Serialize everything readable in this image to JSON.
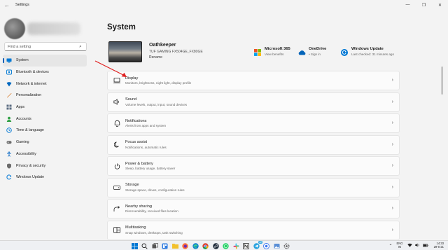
{
  "window": {
    "title": "Settings",
    "back_icon": "back-arrow-icon"
  },
  "sidebar": {
    "search_placeholder": "Find a setting",
    "items": [
      {
        "label": "System",
        "icon": "monitor-icon",
        "color": "#0078d4",
        "selected": true
      },
      {
        "label": "Bluetooth & devices",
        "icon": "bluetooth-icon",
        "color": "#0078d4"
      },
      {
        "label": "Network & internet",
        "icon": "wifi-icon",
        "color": "#0067c0"
      },
      {
        "label": "Personalization",
        "icon": "brush-icon",
        "color": "#d87a25"
      },
      {
        "label": "Apps",
        "icon": "apps-icon",
        "color": "#5a6b80"
      },
      {
        "label": "Accounts",
        "icon": "person-icon",
        "color": "#2ea043"
      },
      {
        "label": "Time & language",
        "icon": "globe-clock-icon",
        "color": "#0078d4"
      },
      {
        "label": "Gaming",
        "icon": "gamepad-icon",
        "color": "#6b6b6b"
      },
      {
        "label": "Accessibility",
        "icon": "accessibility-icon",
        "color": "#1a73c8"
      },
      {
        "label": "Privacy & security",
        "icon": "shield-icon",
        "color": "#6b6b6b"
      },
      {
        "label": "Windows Update",
        "icon": "sync-icon",
        "color": "#0078d4"
      }
    ]
  },
  "main": {
    "title": "System",
    "device": {
      "name": "Oathkeeper",
      "model": "TUF GAMING FX504GE_FX80GE",
      "rename": "Rename"
    },
    "quick": [
      {
        "title": "Microsoft 365",
        "sub": "View benefits",
        "icon": "microsoft-logo-icon"
      },
      {
        "title": "OneDrive",
        "sub": "• Sign in",
        "icon": "cloud-icon"
      },
      {
        "title": "Windows Update",
        "sub": "Last checked: 31 minutes ago",
        "icon": "update-icon"
      }
    ],
    "cards": [
      {
        "title": "Display",
        "sub": "Monitors, brightness, night light, display profile",
        "icon": "display-icon"
      },
      {
        "title": "Sound",
        "sub": "Volume levels, output, input, sound devices",
        "icon": "speaker-icon"
      },
      {
        "title": "Notifications",
        "sub": "Alerts from apps and system",
        "icon": "bell-icon"
      },
      {
        "title": "Focus assist",
        "sub": "Notifications, automatic rules",
        "icon": "moon-icon"
      },
      {
        "title": "Power & battery",
        "sub": "Sleep, battery usage, battery saver",
        "icon": "power-icon"
      },
      {
        "title": "Storage",
        "sub": "Storage space, drives, configuration rules",
        "icon": "storage-icon"
      },
      {
        "title": "Nearby sharing",
        "sub": "Discoverability, received files location",
        "icon": "share-icon"
      },
      {
        "title": "Multitasking",
        "sub": "Snap windows, desktops, task switching",
        "icon": "multitasking-icon"
      }
    ]
  },
  "taskbar": {
    "lang_top": "ENG",
    "lang_bottom": "IN",
    "time": "14:33",
    "date": "29-6-21",
    "badge": "42"
  },
  "colors": {
    "accent": "#005fb8",
    "annotation_arrow": "#e02020"
  }
}
